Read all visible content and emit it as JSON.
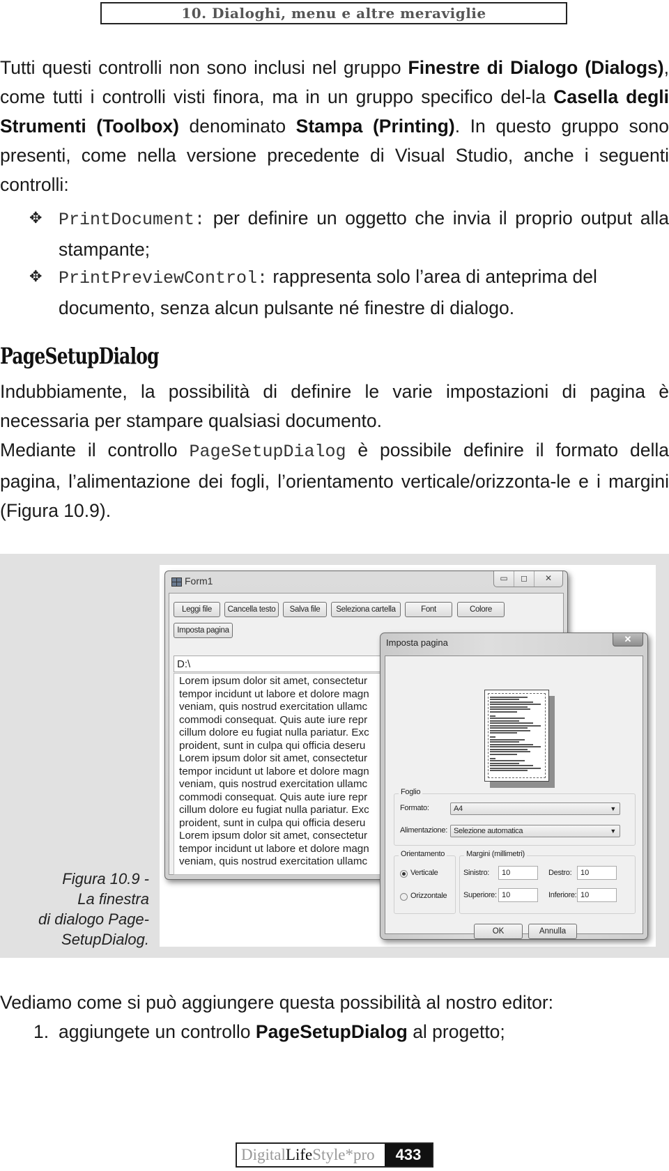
{
  "header": {
    "running_head": "10. Dialoghi, menu e altre meraviglie"
  },
  "intro": {
    "p1_a": "Tutti questi controlli non sono inclusi nel gruppo ",
    "p1_b": "Finestre di Dialogo (Dialogs)",
    "p1_c": ", come tutti i controlli visti finora, ma in un gruppo specifico del-la ",
    "p1_d": "Casella degli Strumenti (Toolbox)",
    "p1_e": " denominato ",
    "p1_f": "Stampa (Printing)",
    "p1_g": ". In questo gruppo sono presenti, come nella versione precedente di Visual Studio, anche i seguenti controlli:"
  },
  "bullets": [
    {
      "glyph": "✥",
      "code": "PrintDocument:",
      "text": " per definire un oggetto che invia il proprio output alla stampante;"
    },
    {
      "glyph": "✥",
      "code": "PrintPreviewControl:",
      "text": " rappresenta solo l’area di anteprima del documento, senza alcun pulsante né finestre di dialogo."
    }
  ],
  "section": {
    "title": "PageSetupDialog",
    "p2": "Indubbiamente, la possibilità di definire le varie impostazioni di pagina è necessaria per stampare qualsiasi documento.",
    "p3_a": "Mediante il controllo ",
    "p3_code": "PageSetupDialog",
    "p3_b": " è possibile definire il formato della pagina, l’alimentazione dei fogli, l’orientamento verticale/orizzonta-le e i margini (Figura 10.9)."
  },
  "figure": {
    "caption": [
      "Figura 10.9 -",
      "La finestra",
      "di dialogo Page-",
      "SetupDialog."
    ],
    "form1": {
      "title": "Form1",
      "caption_buttons": [
        "▭",
        "◻",
        "✕"
      ],
      "buttons": [
        "Leggi file",
        "Cancella testo",
        "Salva file",
        "Seleziona cartella",
        "Font",
        "Colore",
        "Imposta pagina"
      ],
      "path": "D:\\",
      "text_lines": [
        "Lorem ipsum dolor sit amet, consectetur",
        "tempor incidunt ut labore et dolore magn",
        "veniam, quis nostrud exercitation ullamc",
        "commodi consequat. Quis aute iure repr",
        "cillum dolore eu fugiat nulla pariatur. Exc",
        "proident, sunt in culpa qui officia deseru",
        "Lorem ipsum dolor sit amet, consectetur",
        "tempor incidunt ut labore et dolore magn",
        "veniam, quis nostrud exercitation ullamc",
        "commodi consequat. Quis aute iure repr",
        "cillum dolore eu fugiat nulla pariatur. Exc",
        "proident, sunt in culpa qui officia deseru",
        "Lorem ipsum dolor sit amet, consectetur",
        "tempor incidunt ut labore et dolore magn",
        "veniam, quis nostrud exercitation ullamc"
      ]
    },
    "dialog": {
      "title": "Imposta pagina",
      "close": "✕",
      "paper_group": "Foglio",
      "format_label": "Formato:",
      "format_value": "A4",
      "source_label": "Alimentazione:",
      "source_value": "Selezione automatica",
      "orientation_group": "Orientamento",
      "orientation_options": [
        "Verticale",
        "Orizzontale"
      ],
      "orientation_selected": "Verticale",
      "margins_group": "Margini (millimetri)",
      "margins": {
        "left_label": "Sinistro:",
        "left": "10",
        "right_label": "Destro:",
        "right": "10",
        "top_label": "Superiore:",
        "top": "10",
        "bottom_label": "Inferiore:",
        "bottom": "10"
      },
      "ok": "OK",
      "cancel": "Annulla"
    }
  },
  "outro": {
    "p4": "Vediamo come si può aggiungere questa possibilità al nostro editor:",
    "step1_num": "1.",
    "step1_a": "aggiungete un controllo ",
    "step1_b": "PageSetupDialog",
    "step1_c": " al progetto;"
  },
  "footer": {
    "brand_a": "Digital",
    "brand_b": "Life",
    "brand_c": "Style*pro",
    "page": "433"
  }
}
